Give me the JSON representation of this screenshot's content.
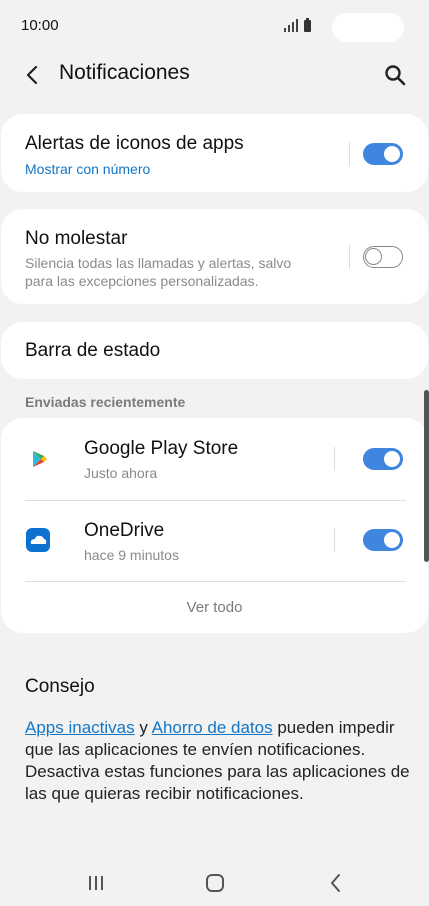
{
  "status_bar": {
    "time": "10:00"
  },
  "header": {
    "title": "Notificaciones"
  },
  "alertas": {
    "title": "Alertas de iconos de apps",
    "subtitle": "Mostrar con número",
    "enabled": true
  },
  "no_molestar": {
    "title": "No molestar",
    "subtitle_line1": "Silencia todas las llamadas y alertas, salvo",
    "subtitle_line2": "para las excepciones personalizadas.",
    "enabled": false
  },
  "barra": {
    "title": "Barra de estado"
  },
  "recent": {
    "section_label": "Enviadas recientemente",
    "apps": [
      {
        "name": "Google Play Store",
        "time": "Justo ahora",
        "enabled": true,
        "icon": "google-play-icon"
      },
      {
        "name": "OneDrive",
        "time": "hace 9 minutos",
        "enabled": true,
        "icon": "onedrive-icon"
      }
    ],
    "view_all": "Ver todo"
  },
  "tip": {
    "title": "Consejo",
    "link1": "Apps inactivas",
    "connector": " y ",
    "link2": "Ahorro de datos",
    "rest": " pueden impedir que las aplicaciones te envíen notificaciones. Desactiva estas funciones para las aplicaciones de las que quieras recibir notificaciones."
  },
  "colors": {
    "accent": "#3e86df",
    "link": "#1576c5",
    "background": "#f2f2f2"
  }
}
